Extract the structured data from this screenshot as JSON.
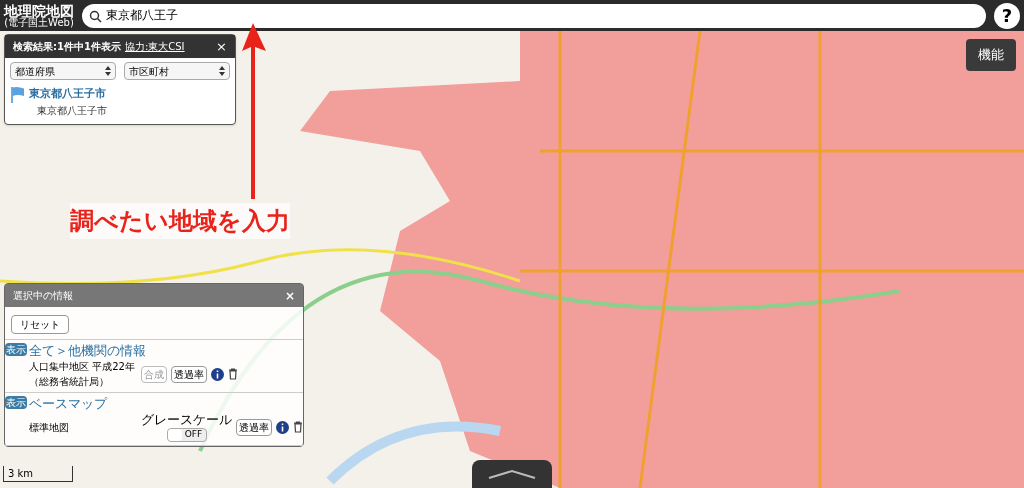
{
  "header": {
    "title": "地理院地図",
    "subtitle": "(電子国土Web)",
    "search_value": "東京都八王子",
    "help": "?"
  },
  "function_button": "機能",
  "search_panel": {
    "title": "検索結果:1件中1件表示",
    "credit": "協力:東大CSI",
    "close": "×",
    "selects": [
      "都道府県",
      "市区町村"
    ],
    "results": [
      {
        "name": "東京都八王子市",
        "address": "東京都八王子市"
      }
    ]
  },
  "layers_panel": {
    "title": "選択中の情報",
    "close": "×",
    "reset": "リセット",
    "layers": [
      {
        "kind": "overlay",
        "badge": "表示",
        "path": "全て＞他機関の情報",
        "name": "人口集中地区 平成22年（総務省統計局）",
        "composite": "合成",
        "opacity": "透過率"
      },
      {
        "kind": "base",
        "badge": "表示",
        "path": "ベースマップ",
        "name": "標準地図",
        "grayscale_label": "グレースケール",
        "toggle": "OFF",
        "on": false,
        "opacity": "透過率"
      }
    ]
  },
  "scale": "3 km",
  "annotation": "調べたい地域を入力"
}
